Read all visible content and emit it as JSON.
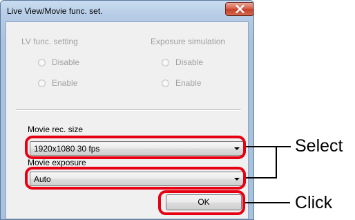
{
  "window": {
    "title": "Live View/Movie func. set."
  },
  "lv_func": {
    "title": "LV func. setting",
    "options": [
      "Disable",
      "Enable"
    ]
  },
  "exposure_sim": {
    "title": "Exposure simulation",
    "options": [
      "Disable",
      "Enable"
    ]
  },
  "movie_rec_size": {
    "label": "Movie rec. size",
    "value": "1920x1080  30 fps"
  },
  "movie_exposure": {
    "label": "Movie exposure",
    "value": "Auto"
  },
  "ok_button": {
    "label": "OK"
  },
  "callouts": {
    "select_label": "Select",
    "click_label": "Click",
    "ring_color": "#e60012"
  },
  "icons": {
    "close": "close-x-icon",
    "dropdown": "chevron-down-icon"
  }
}
